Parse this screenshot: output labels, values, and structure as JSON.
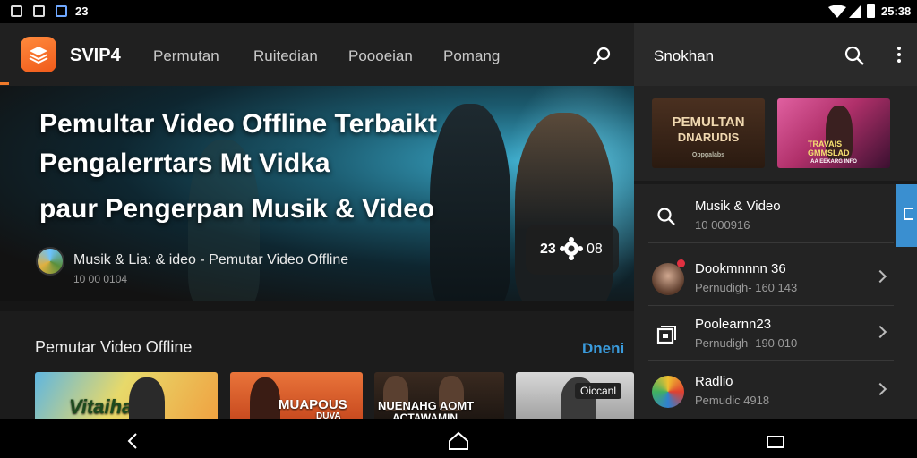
{
  "status_bar": {
    "notification_count": "23",
    "time": "25:38"
  },
  "app": {
    "title": "SVIP4",
    "tabs": [
      {
        "label": "Permutan"
      },
      {
        "label": "Ruitedian"
      },
      {
        "label": "Poooeian"
      },
      {
        "label": "Pomang"
      }
    ]
  },
  "hero": {
    "title_lines": [
      "Pemultar Video Offline Terbaikt",
      "Pengalerrtars Mt Vidka",
      "paur Pengerpan Musik & Video"
    ],
    "channel": "Musik & Lia: & ideo - Pemutar Video Offline",
    "subtitle": "10 00 0104",
    "badge_left": "23",
    "badge_right": "08"
  },
  "section": {
    "title": "Pemutar Video Offline",
    "link": "Dneni",
    "thumbnails": [
      {
        "caption": "Vitaiha",
        "color": "#e7d96a"
      },
      {
        "caption_top": "MUAPOUS",
        "caption_bottom": "DUVA",
        "color": "#e9743a"
      },
      {
        "caption_top": "NUENAHG AOMT",
        "caption_bottom": "ACTAWAMIN",
        "color": "#3a2a20"
      },
      {
        "badge": "Oiccanl",
        "color": "#cfcfcf"
      }
    ]
  },
  "panel": {
    "title": "Snokhan",
    "posters": [
      {
        "line1": "PEMULTAN",
        "line2": "DNARUDIS",
        "footer": "Oppgalabs",
        "color": "#3a2416"
      },
      {
        "line1": "TRAVAIS",
        "line2": "GMMSLAD",
        "footer": "AA EEKARG INFO",
        "color": "#b0306a"
      }
    ],
    "rows": [
      {
        "title": "Musik & Video",
        "subtitle": "10 000916",
        "icon": "search-icon"
      },
      {
        "title": "Dookmnnnn 36",
        "subtitle": "Pernudigh- 160 143",
        "icon": "avatar-woman"
      },
      {
        "title": "Poolearnn23",
        "subtitle": "Pernudigh- 190 010",
        "icon": "library-icon"
      },
      {
        "title": "Radlio",
        "subtitle": "Pemudic 4918",
        "icon": "radio-avatar"
      }
    ]
  },
  "colors": {
    "accent": "#f07a2a",
    "link": "#3a9bdc",
    "side_tab": "#3a8fd0"
  }
}
